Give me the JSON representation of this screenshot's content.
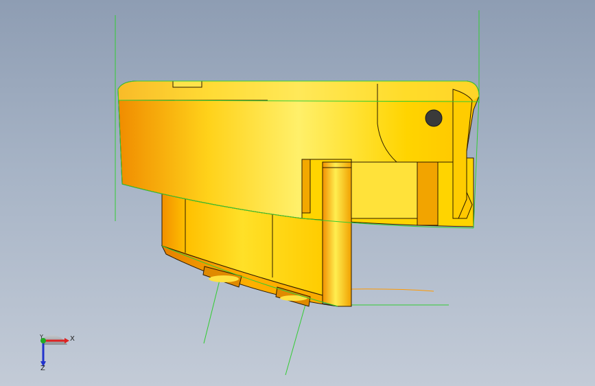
{
  "viewport": {
    "background_top": "#8e9db3",
    "background_bottom": "#c3cbd7"
  },
  "model": {
    "body_color": "#ffcc00",
    "shade_color": "#f08c00",
    "highlight_color": "#fff38a",
    "edge_color": "#2a1a00",
    "selection_edge_color": "#33cc33",
    "hole_color": "#3a3a3a"
  },
  "axis_triad": {
    "x_label": "X",
    "y_label": "Y",
    "z_label": "Z",
    "x_color": "#dd2222",
    "y_color": "#22aa22",
    "z_color": "#2233cc"
  }
}
